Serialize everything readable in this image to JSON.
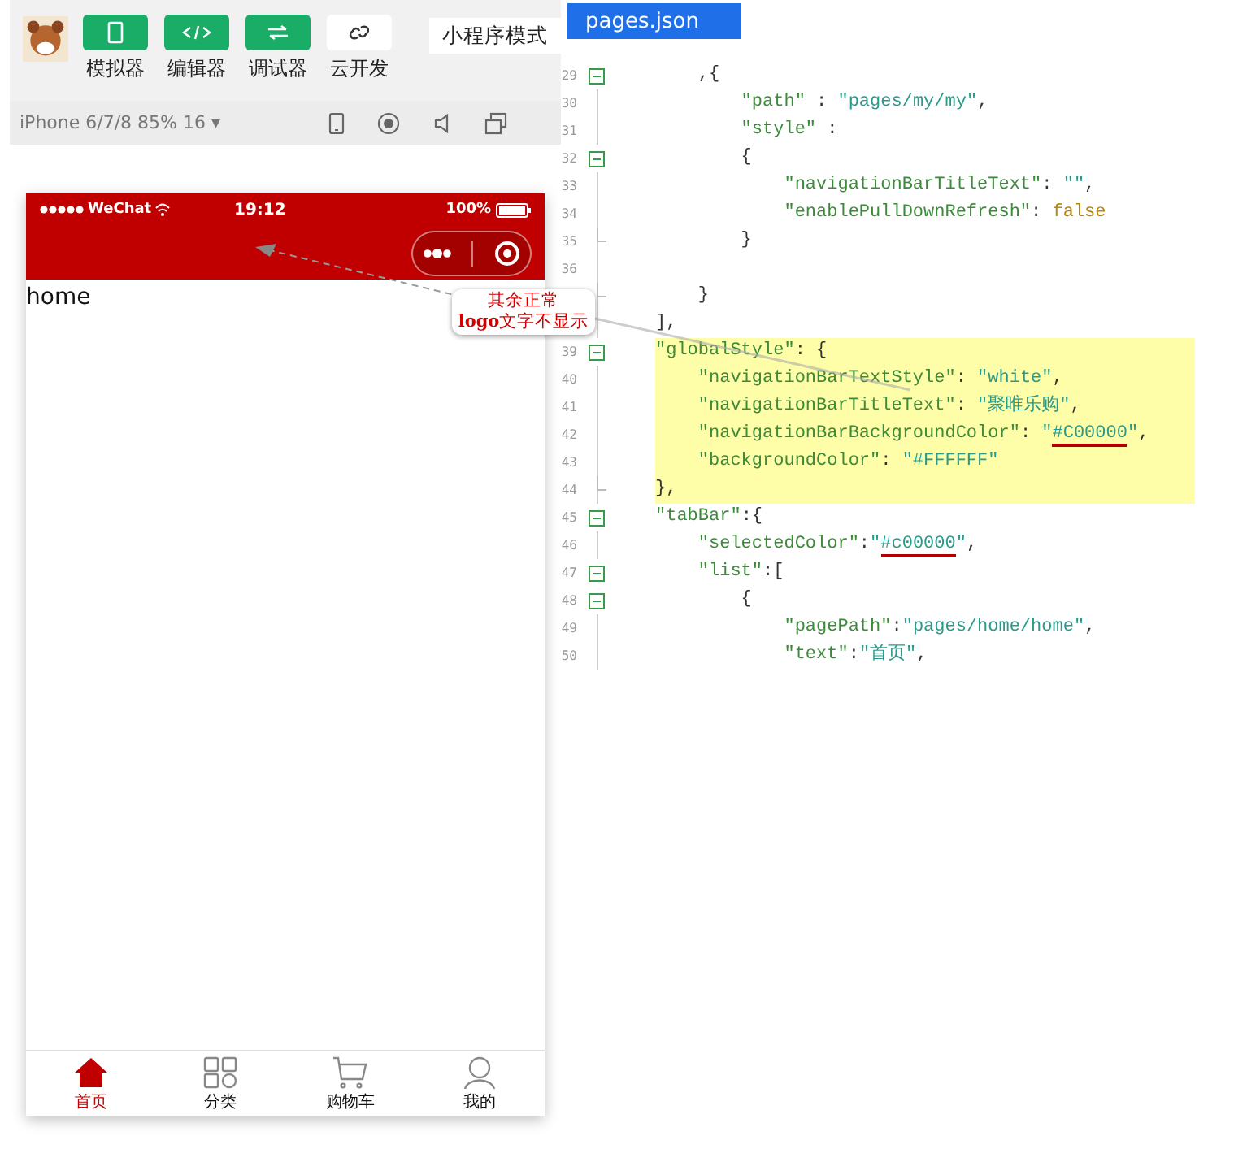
{
  "toolbar": {
    "buttons": [
      {
        "label": "模拟器",
        "kind": "simulator",
        "on": true
      },
      {
        "label": "编辑器",
        "kind": "editor",
        "on": true
      },
      {
        "label": "调试器",
        "kind": "debugger",
        "on": true
      },
      {
        "label": "云开发",
        "kind": "cloud",
        "on": false
      }
    ],
    "mode": "小程序模式"
  },
  "device_bar": {
    "device": "iPhone 6/7/8 85% 16 ▾"
  },
  "phone": {
    "status_bar": {
      "carrier": "WeChat",
      "time": "19:12",
      "battery": "100%"
    },
    "page_text": "home",
    "tab_bar": [
      {
        "label": "首页",
        "kind": "home",
        "selected": true
      },
      {
        "label": "分类",
        "kind": "category",
        "selected": false
      },
      {
        "label": "购物车",
        "kind": "cart",
        "selected": false
      },
      {
        "label": "我的",
        "kind": "profile",
        "selected": false
      }
    ]
  },
  "annotation": {
    "text": "其余正常\n**logo**文字不显示"
  },
  "editor": {
    "tab": "pages.json",
    "lines": [
      {
        "number": "29",
        "kind": "opener",
        "highlighted": false,
        "tokens": [
          {
            "kind": "punct",
            "text": "    ,{"
          }
        ]
      },
      {
        "number": "30",
        "kind": "plain",
        "highlighted": false,
        "tokens": [
          {
            "kind": "key",
            "text": "        \"path\""
          },
          {
            "kind": "punct",
            "text": " : "
          },
          {
            "kind": "string",
            "text": "\"pages/my/my\""
          },
          {
            "kind": "punct",
            "text": ","
          }
        ]
      },
      {
        "number": "31",
        "kind": "plain",
        "highlighted": false,
        "tokens": [
          {
            "kind": "key",
            "text": "        \"style\""
          },
          {
            "kind": "punct",
            "text": " :"
          }
        ]
      },
      {
        "number": "32",
        "kind": "opener",
        "highlighted": false,
        "tokens": [
          {
            "kind": "punct",
            "text": "        {"
          }
        ]
      },
      {
        "number": "33",
        "kind": "plain",
        "highlighted": false,
        "tokens": [
          {
            "kind": "key",
            "text": "            \"navigationBarTitleText\""
          },
          {
            "kind": "punct",
            "text": ": "
          },
          {
            "kind": "string",
            "text": "\"\""
          },
          {
            "kind": "punct",
            "text": ","
          }
        ]
      },
      {
        "number": "34",
        "kind": "plain",
        "highlighted": false,
        "tokens": [
          {
            "kind": "key",
            "text": "            \"enablePullDownRefresh\""
          },
          {
            "kind": "punct",
            "text": ": "
          },
          {
            "kind": "bool",
            "text": "false"
          }
        ]
      },
      {
        "number": "35",
        "kind": "closer",
        "highlighted": false,
        "tokens": [
          {
            "kind": "punct",
            "text": "        }"
          }
        ]
      },
      {
        "number": "36",
        "kind": "plain",
        "highlighted": false
      },
      {
        "kind": "closer",
        "highlighted": false,
        "tokens": [
          {
            "kind": "punct",
            "text": "    }"
          }
        ]
      },
      {
        "kind": "plain",
        "highlighted": false,
        "tokens": [
          {
            "kind": "punct",
            "text": "],"
          }
        ]
      },
      {
        "number": "39",
        "kind": "opener",
        "highlighted": true,
        "tokens": [
          {
            "kind": "key",
            "text": "\"globalStyle\""
          },
          {
            "kind": "punct",
            "text": ": {"
          }
        ]
      },
      {
        "number": "40",
        "kind": "plain",
        "highlighted": true,
        "tokens": [
          {
            "kind": "key",
            "text": "    \"navigationBarTextStyle\""
          },
          {
            "kind": "punct",
            "text": ": "
          },
          {
            "kind": "string",
            "text": "\"white\""
          },
          {
            "kind": "punct",
            "text": ","
          }
        ]
      },
      {
        "number": "41",
        "kind": "plain",
        "highlighted": true,
        "tokens": [
          {
            "kind": "key",
            "text": "    \"navigationBarTitleText\""
          },
          {
            "kind": "punct",
            "text": ": "
          },
          {
            "kind": "string",
            "text": "\"聚唯乐购\""
          },
          {
            "kind": "punct",
            "text": ","
          }
        ]
      },
      {
        "number": "42",
        "kind": "plain",
        "highlighted": true,
        "tokens": [
          {
            "kind": "key",
            "text": "    \"navigationBarBackgroundColor\""
          },
          {
            "kind": "punct",
            "text": ": "
          },
          {
            "kind": "string",
            "text": "\""
          },
          {
            "kind": "string",
            "text": "#C00000",
            "underline": true
          },
          {
            "kind": "string",
            "text": "\""
          },
          {
            "kind": "punct",
            "text": ","
          }
        ]
      },
      {
        "number": "43",
        "kind": "plain",
        "highlighted": true,
        "tokens": [
          {
            "kind": "key",
            "text": "    \"backgroundColor\""
          },
          {
            "kind": "punct",
            "text": ": "
          },
          {
            "kind": "string",
            "text": "\"#FFFFFF\""
          }
        ]
      },
      {
        "number": "44",
        "kind": "closer",
        "highlighted": true,
        "tokens": [
          {
            "kind": "punct",
            "text": "},"
          }
        ]
      },
      {
        "number": "45",
        "kind": "opener",
        "highlighted": false,
        "tokens": [
          {
            "kind": "key",
            "text": "\"tabBar\""
          },
          {
            "kind": "punct",
            "text": ":{"
          }
        ]
      },
      {
        "number": "46",
        "kind": "plain",
        "highlighted": false,
        "tokens": [
          {
            "kind": "key",
            "text": "    \"selectedColor\""
          },
          {
            "kind": "punct",
            "text": ":"
          },
          {
            "kind": "string",
            "text": "\""
          },
          {
            "kind": "string",
            "text": "#c00000",
            "underline": true
          },
          {
            "kind": "string",
            "text": "\""
          },
          {
            "kind": "punct",
            "text": ","
          }
        ]
      },
      {
        "number": "47",
        "kind": "opener",
        "highlighted": false,
        "tokens": [
          {
            "kind": "key",
            "text": "    \"list\""
          },
          {
            "kind": "punct",
            "text": ":["
          }
        ]
      },
      {
        "number": "48",
        "kind": "opener",
        "highlighted": false,
        "tokens": [
          {
            "kind": "punct",
            "text": "        {"
          }
        ]
      },
      {
        "number": "49",
        "kind": "plain",
        "highlighted": false,
        "tokens": [
          {
            "kind": "key",
            "text": "            \"pagePath\""
          },
          {
            "kind": "punct",
            "text": ":"
          },
          {
            "kind": "string",
            "text": "\"pages/home/home\""
          },
          {
            "kind": "punct",
            "text": ","
          }
        ]
      },
      {
        "number": "50",
        "kind": "plain",
        "highlighted": false,
        "tokens": [
          {
            "kind": "key",
            "text": "            \"text\""
          },
          {
            "kind": "punct",
            "text": ":"
          },
          {
            "kind": "string",
            "text": "\"首页\""
          },
          {
            "kind": "punct",
            "text": ","
          }
        ]
      }
    ]
  }
}
